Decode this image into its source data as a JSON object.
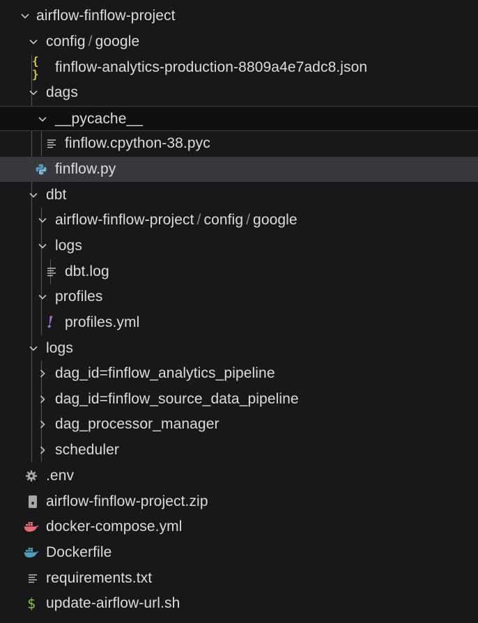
{
  "explorer": {
    "root_label": "airflow-finflow-project",
    "config_google": {
      "part1": "config",
      "separator": "/",
      "part2": "google"
    },
    "json_file": "finflow-analytics-production-8809a4e7adc8.json",
    "json_icon_glyph": "{ }",
    "dags": "dags",
    "pycache": "__pycache__",
    "pyc_file": "finflow.cpython-38.pyc",
    "py_file": "finflow.py",
    "dbt": "dbt",
    "dbt_nested": {
      "part1": "airflow-finflow-project",
      "sep1": "/",
      "part2": "config",
      "sep2": "/",
      "part3": "google"
    },
    "dbt_logs": "logs",
    "dbt_log_file": "dbt.log",
    "profiles": "profiles",
    "profiles_file": "profiles.yml",
    "yaml_icon_glyph": "!",
    "logs": "logs",
    "logs_children": [
      "dag_id=finflow_analytics_pipeline",
      "dag_id=finflow_source_data_pipeline",
      "dag_processor_manager",
      "scheduler"
    ],
    "env_file": ".env",
    "zip_file": "airflow-finflow-project.zip",
    "compose_file": "docker-compose.yml",
    "dockerfile": "Dockerfile",
    "requirements_file": "requirements.txt",
    "shell_file": "update-airflow-url.sh",
    "shell_icon_glyph": "$"
  },
  "icons": {
    "expanded": "chevron-down-icon",
    "collapsed": "chevron-right-icon",
    "json": "json-braces-icon",
    "python": "python-icon",
    "text": "text-lines-icon",
    "yaml": "yaml-exclamation-icon",
    "settings": "gear-icon",
    "zip": "zip-icon",
    "docker": "docker-whale-icon",
    "shell": "dollar-icon"
  },
  "colors": {
    "background": "#18181a",
    "selected_row": "#37373d",
    "sticky_background": "#101012",
    "text": "#dcdcdc",
    "json_icon": "#cbcb41",
    "python_icon": "#519aba",
    "yaml_icon": "#a074c4",
    "docker_compose_icon": "#e06c75",
    "dockerfile_icon": "#519aba",
    "shell_icon": "#8dc149"
  }
}
